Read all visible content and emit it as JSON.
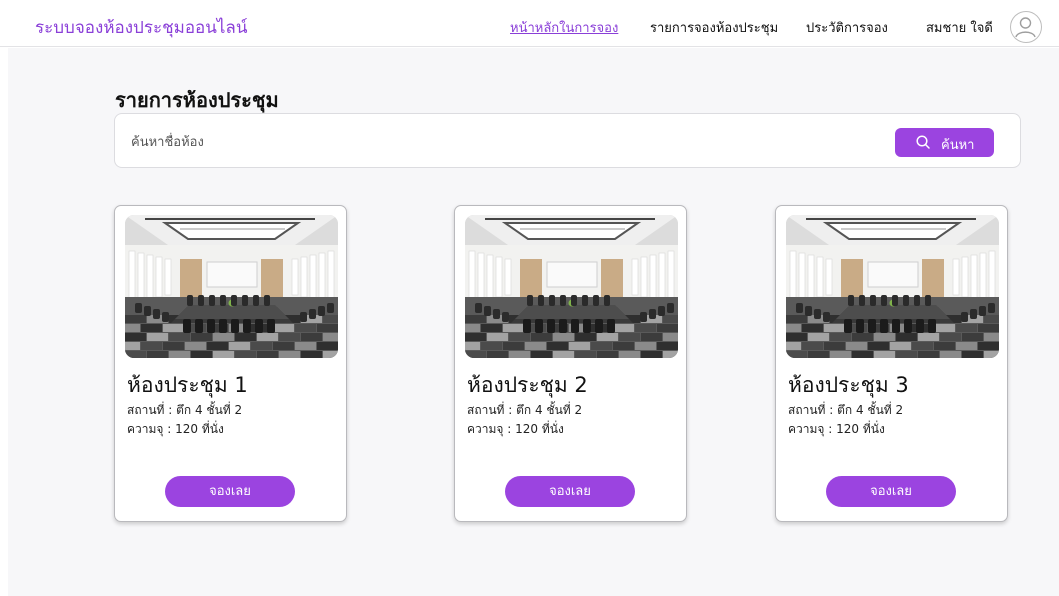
{
  "header": {
    "brand": "ระบบจองห้องประชุมออนไลน์",
    "nav": [
      {
        "label": "หน้าหลักในการจอง",
        "active": true
      },
      {
        "label": "รายการจองห้องประชุม",
        "active": false
      },
      {
        "label": "ประวัติการจอง",
        "active": false
      }
    ],
    "user_name": "สมชาย ใจดี",
    "avatar_icon": "user-avatar-icon"
  },
  "main": {
    "title": "รายการห้องประชุม",
    "search": {
      "placeholder": "ค้นหาชื่อห้อง",
      "value": "",
      "button_label": "ค้นหา",
      "button_icon": "search-icon"
    },
    "rooms": [
      {
        "name": "ห้องประชุม 1",
        "location": "สถานที่ : ตึก 4 ชั้นที่ 2",
        "capacity": "ความจุ : 120 ที่นั่ง",
        "button_label": "จองเลย",
        "image": "conference-room-photo"
      },
      {
        "name": "ห้องประชุม 2",
        "location": "สถานที่ : ตึก 4 ชั้นที่ 2",
        "capacity": "ความจุ : 120 ที่นั่ง",
        "button_label": "จองเลย",
        "image": "conference-room-photo"
      },
      {
        "name": "ห้องประชุม 3",
        "location": "สถานที่ : ตึก 4 ชั้นที่ 2",
        "capacity": "ความจุ : 120 ที่นั่ง",
        "button_label": "จองเลย",
        "image": "conference-room-photo"
      }
    ]
  },
  "colors": {
    "accent": "#9b44e0",
    "brand_text": "#8a3fd8",
    "background": "#f7f7f9",
    "card_border": "#b9b9bd"
  }
}
